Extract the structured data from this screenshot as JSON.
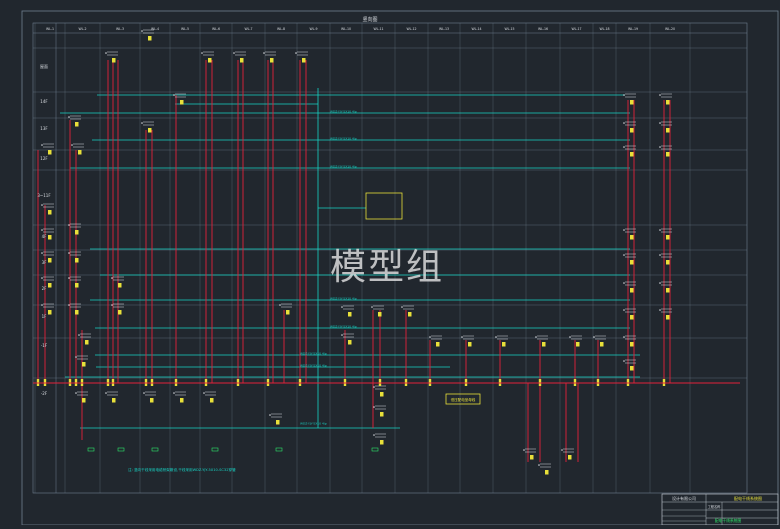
{
  "header_tag": "竖向图",
  "watermark": "模型组",
  "level_labels": [
    "屋面",
    "14F",
    "13F",
    "12F",
    "3~11F",
    "4F",
    "3F",
    "2F",
    "1F",
    "-1F",
    "-2F"
  ],
  "riser_headers": [
    "WL-1",
    "WL-2",
    "WL-3",
    "WL-4",
    "WL-5",
    "WL-6",
    "WL-7",
    "WL-8",
    "WL-9",
    "WL-10",
    "WL-11",
    "WL-12",
    "WL-13",
    "WL-14",
    "WL-15",
    "WL-16",
    "WL-17",
    "WL-18",
    "WL-19",
    "WL-20"
  ],
  "cable_labels": [
    "WDZ-YJY-5X10 4/p",
    "WDZ-YJY-5X10 4/p",
    "WDZ-YJY-5X10 4/p",
    "WDZ-YJY-5X10 4/p",
    "WDZ-YJY-5X10 4/p",
    "WDZ-YJY-5X10 4/p",
    "WDZ-YJY-5X10 4/p",
    "WDZ-YJY-5X10 4/p"
  ],
  "bus_label": "低压配电室母线",
  "bottom_note": "注: 竖向干线采用电缆桥架敷设,干线采用WDZ-YJY-5X10-SC32穿管",
  "title_block": {
    "company": "设计有限公司",
    "drawing_title": "配电干线系统图",
    "project_label": "工程名称",
    "stamp": "配电干线系统图"
  },
  "colors": {
    "background": "#21272e",
    "frame": "#6f7f8f",
    "trunk": "#17d3c4",
    "riser": "#e2223a",
    "panel": "#e8e03a",
    "text": "#d9dde2",
    "watermark": "#e6e6e6"
  }
}
